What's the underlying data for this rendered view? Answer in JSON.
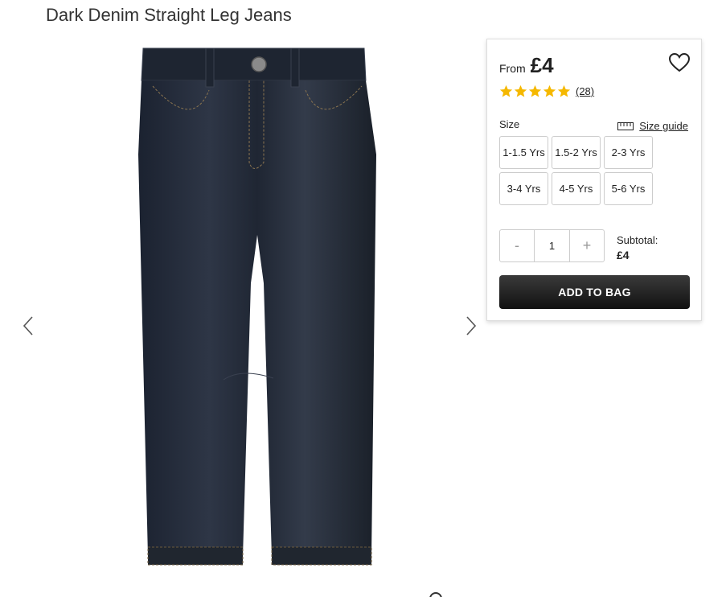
{
  "product": {
    "title": "Dark Denim Straight Leg Jeans"
  },
  "price": {
    "from_label": "From",
    "value": "£4"
  },
  "rating": {
    "stars": 5,
    "review_count": "(28)",
    "star_color": "#f5b800"
  },
  "size": {
    "label": "Size",
    "guide_label": "Size guide",
    "options": [
      "1-1.5 Yrs",
      "1.5-2 Yrs",
      "2-3 Yrs",
      "3-4 Yrs",
      "4-5 Yrs",
      "5-6 Yrs"
    ]
  },
  "quantity": {
    "minus": "-",
    "value": "1",
    "plus": "+"
  },
  "subtotal": {
    "label": "Subtotal:",
    "amount": "£4"
  },
  "actions": {
    "add_to_bag": "ADD TO BAG"
  },
  "icons": {
    "wishlist": "heart-icon",
    "prev": "chevron-left-icon",
    "next": "chevron-right-icon",
    "size_guide": "ruler-icon"
  }
}
